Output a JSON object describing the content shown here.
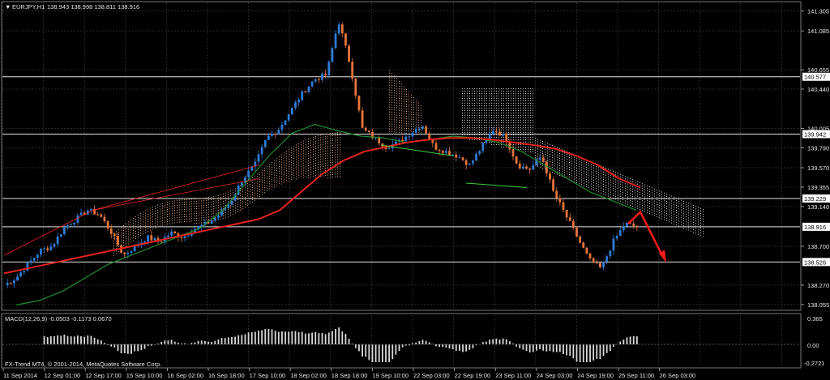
{
  "header": {
    "symbol": "EURJPY,H1",
    "ohlc": "138.943 138.998 138.811 138.916"
  },
  "indicator": {
    "macd_label": "MACD(12,26,9) -0.0503 -0.1173 0.0670",
    "macd_axis": [
      "0.365",
      "0.00",
      "-0.2721"
    ]
  },
  "footer": {
    "copyright": "FX-Trend MT4, © 2001-2014, MetaQuotes Software Corp."
  },
  "colors": {
    "background": "#000000",
    "grid": "#3a3a3a",
    "bull": "#2f7bd6",
    "bear": "#e8743b",
    "ma_red": "#e8231f",
    "ma_green": "#1f8f2a",
    "cloud": "#d9a27a",
    "cloud_grey": "#cfcfcf"
  },
  "chart_data": {
    "type": "line",
    "y_ticks": [
      "141.305",
      "141.085",
      "140.655",
      "140.440",
      "140.005",
      "139.790",
      "139.570",
      "139.355",
      "139.140",
      "138.700",
      "138.270",
      "138.055"
    ],
    "price_levels": [
      "140.577",
      "139.942",
      "139.229",
      "138.916",
      "138.526"
    ],
    "x_ticks": [
      "11 Sep 2014",
      "12 Sep 01:00",
      "12 Sep 17:00",
      "15 Sep 10:00",
      "16 Sep 02:00",
      "16 Sep 18:00",
      "17 Sep 10:00",
      "18 Sep 02:00",
      "18 Sep 18:00",
      "19 Sep 10:00",
      "22 Sep 03:00",
      "22 Sep 19:00",
      "23 Sep 11:00",
      "24 Sep 03:00",
      "24 Sep 19:00",
      "25 Sep 11:00",
      "26 Sep 03:00"
    ],
    "ylim": [
      138.0,
      141.4
    ],
    "close_path": [
      138.27,
      138.35,
      138.5,
      138.65,
      138.7,
      138.9,
      139.0,
      139.1,
      139.05,
      138.85,
      138.6,
      138.7,
      138.8,
      138.75,
      138.85,
      138.8,
      138.9,
      138.95,
      139.05,
      139.2,
      139.45,
      139.6,
      139.9,
      140.0,
      140.2,
      140.4,
      140.55,
      140.6,
      141.2,
      140.7,
      140.0,
      139.9,
      139.8,
      139.85,
      139.95,
      140.05,
      139.8,
      139.75,
      139.7,
      139.6,
      139.8,
      140.0,
      139.9,
      139.6,
      139.55,
      139.7,
      139.3,
      139.05,
      138.8,
      138.55,
      138.45,
      138.75,
      138.95,
      138.916
    ],
    "red_ma": [
      138.4,
      138.45,
      138.5,
      138.55,
      138.6,
      138.65,
      138.7,
      138.75,
      138.8,
      138.85,
      138.9,
      138.95,
      139.0,
      139.1,
      139.3,
      139.5,
      139.65,
      139.75,
      139.8,
      139.85,
      139.88,
      139.9,
      139.9,
      139.88,
      139.85,
      139.82,
      139.78,
      139.7,
      139.6,
      139.45,
      139.35
    ],
    "green_ma": [
      138.05,
      138.1,
      138.2,
      138.35,
      138.5,
      138.6,
      138.7,
      138.8,
      138.9,
      139.1,
      139.4,
      139.7,
      139.95,
      140.05,
      139.98,
      139.92,
      139.9,
      139.85,
      139.88,
      139.92,
      139.9,
      139.85,
      139.75,
      139.6,
      139.45,
      139.3,
      139.2,
      139.1
    ]
  }
}
